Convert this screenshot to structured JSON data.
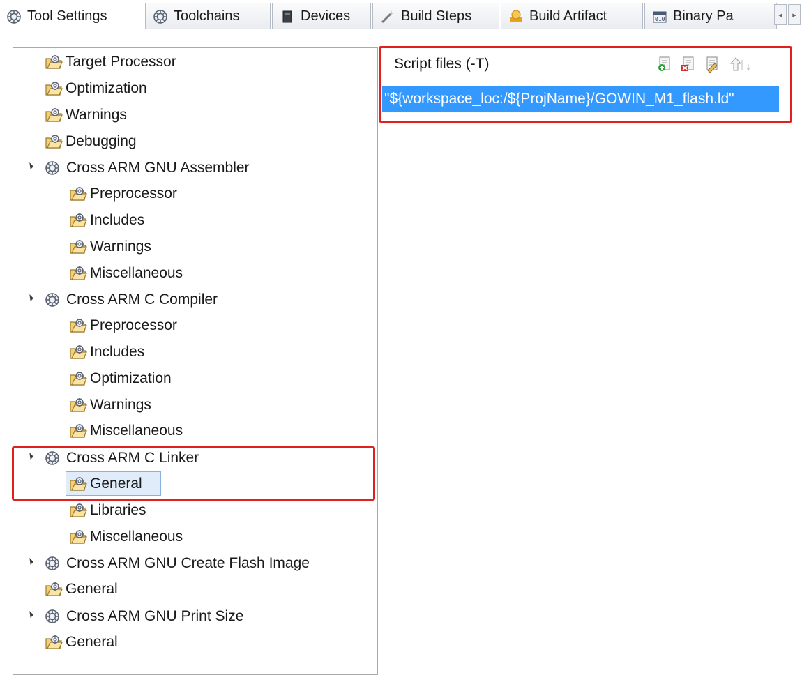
{
  "tabs": [
    {
      "label": "Tool Settings",
      "icon": "gear-icon",
      "active": true
    },
    {
      "label": "Toolchains",
      "icon": "gear-icon"
    },
    {
      "label": "Devices",
      "icon": "chip-icon"
    },
    {
      "label": "Build Steps",
      "icon": "wand-icon"
    },
    {
      "label": "Build Artifact",
      "icon": "artifact-icon"
    },
    {
      "label": "Binary Pa",
      "icon": "binary-icon"
    }
  ],
  "tree": [
    {
      "label": "Target Processor",
      "icon": "folder-icon",
      "level": 1
    },
    {
      "label": "Optimization",
      "icon": "folder-icon",
      "level": 1
    },
    {
      "label": "Warnings",
      "icon": "folder-icon",
      "level": 1
    },
    {
      "label": "Debugging",
      "icon": "folder-icon",
      "level": 1
    },
    {
      "label": "Cross ARM GNU Assembler",
      "icon": "gear-icon",
      "level": 0,
      "expanded": true
    },
    {
      "label": "Preprocessor",
      "icon": "folder-icon",
      "level": 2
    },
    {
      "label": "Includes",
      "icon": "folder-icon",
      "level": 2
    },
    {
      "label": "Warnings",
      "icon": "folder-icon",
      "level": 2
    },
    {
      "label": "Miscellaneous",
      "icon": "folder-icon",
      "level": 2
    },
    {
      "label": "Cross ARM C Compiler",
      "icon": "gear-icon",
      "level": 0,
      "expanded": true
    },
    {
      "label": "Preprocessor",
      "icon": "folder-icon",
      "level": 2
    },
    {
      "label": "Includes",
      "icon": "folder-icon",
      "level": 2
    },
    {
      "label": "Optimization",
      "icon": "folder-icon",
      "level": 2
    },
    {
      "label": "Warnings",
      "icon": "folder-icon",
      "level": 2
    },
    {
      "label": "Miscellaneous",
      "icon": "folder-icon",
      "level": 2
    },
    {
      "label": "Cross ARM C Linker",
      "icon": "gear-icon",
      "level": 0,
      "expanded": true
    },
    {
      "label": "General",
      "icon": "folder-icon",
      "level": 2,
      "selected": true
    },
    {
      "label": "Libraries",
      "icon": "folder-icon",
      "level": 2
    },
    {
      "label": "Miscellaneous",
      "icon": "folder-icon",
      "level": 2
    },
    {
      "label": "Cross ARM GNU Create Flash Image",
      "icon": "gear-icon",
      "level": 0,
      "expanded": true
    },
    {
      "label": "General",
      "icon": "folder-icon",
      "level": 1
    },
    {
      "label": "Cross ARM GNU Print Size",
      "icon": "gear-icon",
      "level": 0,
      "expanded": true
    },
    {
      "label": "General",
      "icon": "folder-icon",
      "level": 1
    }
  ],
  "script_files": {
    "title": "Script files (-T)",
    "toolbar": [
      "add-icon",
      "delete-icon",
      "edit-icon",
      "move-up-icon",
      "move-down-icon"
    ],
    "items": [
      "\"${workspace_loc:/${ProjName}/GOWIN_M1_flash.ld\""
    ]
  },
  "colors": {
    "selection": "#3399ff",
    "highlight_border": "#e12020",
    "tree_selection": "#e1ecfb"
  }
}
